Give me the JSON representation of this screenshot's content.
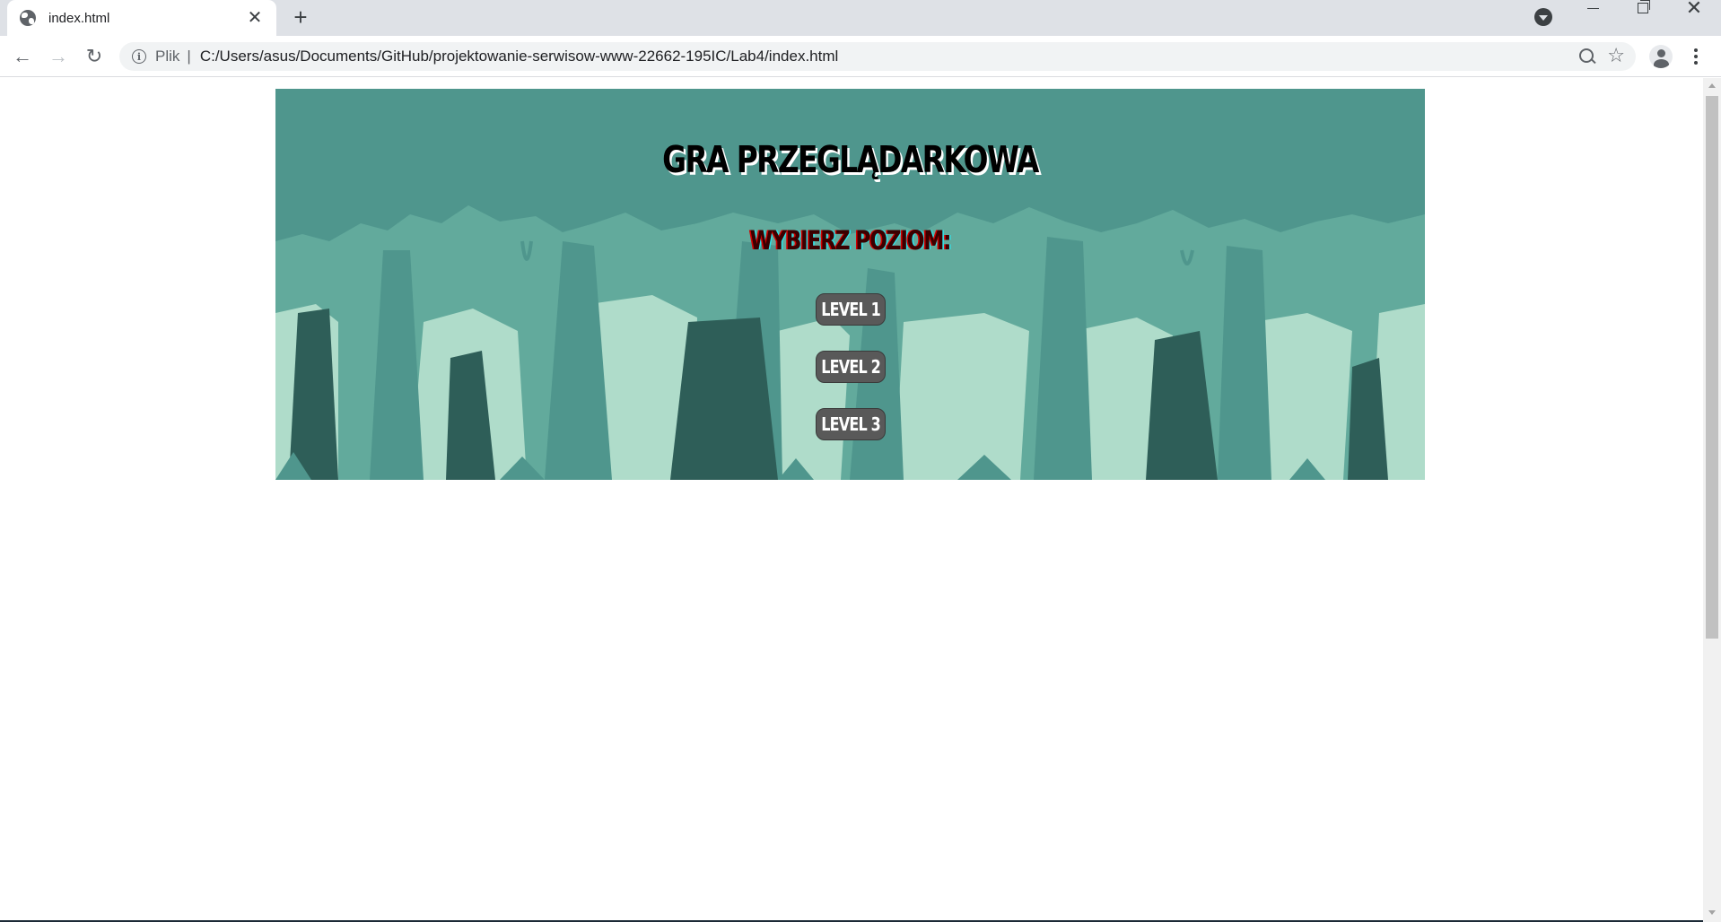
{
  "browser": {
    "tab_title": "index.html",
    "tab_close_glyph": "✕",
    "new_tab_glyph": "+",
    "security_chip": "Plik",
    "chip_separator": "|",
    "url": "C:/Users/asus/Documents/GitHub/projektowanie-serwisow-www-22662-195IC/Lab4/index.html",
    "icons": [
      "globe-icon",
      "back-arrow-icon",
      "forward-arrow-icon",
      "reload-icon",
      "info-icon",
      "zoom-icon",
      "bookmark-star-icon",
      "profile-icon",
      "menu-icon",
      "tab-search-icon"
    ],
    "glyphs": {
      "back": "←",
      "forward": "→",
      "reload": "↻",
      "info": "i",
      "star": "☆",
      "close": "✕"
    }
  },
  "game": {
    "title": "GRA PRZEGLĄDARKOWA",
    "subtitle": "WYBIERZ POZIOM:",
    "levels": [
      {
        "label": "LEVEL 1"
      },
      {
        "label": "LEVEL 2"
      },
      {
        "label": "LEVEL 3"
      }
    ],
    "colors": {
      "sky": "#4f968d",
      "tree_mid": "#62aa9c",
      "foreground_light": "#afdcca",
      "trunk_dark": "#2e5e58",
      "button_bg": "#595959",
      "title_text": "#000000",
      "subtitle_text": "#3a0000"
    }
  }
}
